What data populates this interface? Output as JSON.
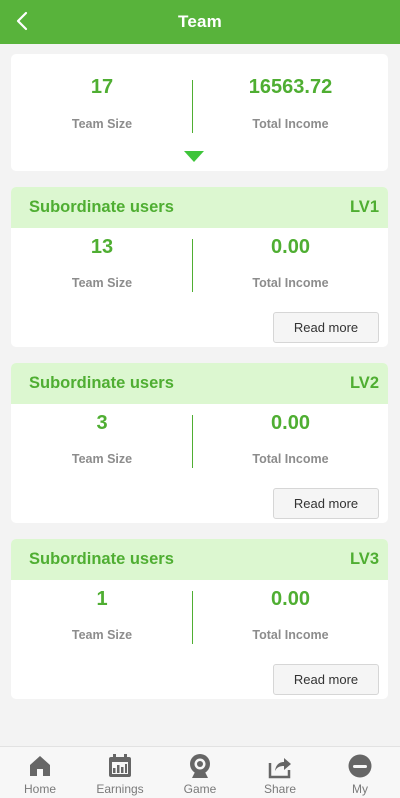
{
  "header": {
    "title": "Team"
  },
  "summary": {
    "team_size": "17",
    "team_size_label": "Team Size",
    "total_income": "16563.72",
    "total_income_label": "Total Income"
  },
  "levels": [
    {
      "title": "Subordinate users",
      "level": "LV1",
      "team_size": "13",
      "team_size_label": "Team Size",
      "total_income": "0.00",
      "total_income_label": "Total Income",
      "button": "Read more"
    },
    {
      "title": "Subordinate users",
      "level": "LV2",
      "team_size": "3",
      "team_size_label": "Team Size",
      "total_income": "0.00",
      "total_income_label": "Total Income",
      "button": "Read more"
    },
    {
      "title": "Subordinate users",
      "level": "LV3",
      "team_size": "1",
      "team_size_label": "Team Size",
      "total_income": "0.00",
      "total_income_label": "Total Income",
      "button": "Read more"
    }
  ],
  "tabbar": [
    {
      "label": "Home",
      "icon": "home-icon"
    },
    {
      "label": "Earnings",
      "icon": "calendar-chart-icon"
    },
    {
      "label": "Game",
      "icon": "webcam-icon"
    },
    {
      "label": "Share",
      "icon": "share-icon"
    },
    {
      "label": "My",
      "icon": "profile-icon"
    }
  ],
  "colors": {
    "brand_green": "#58b33b",
    "value_green": "#4fae32",
    "header_tint": "#dcf7d0",
    "icon_gray": "#666666"
  }
}
